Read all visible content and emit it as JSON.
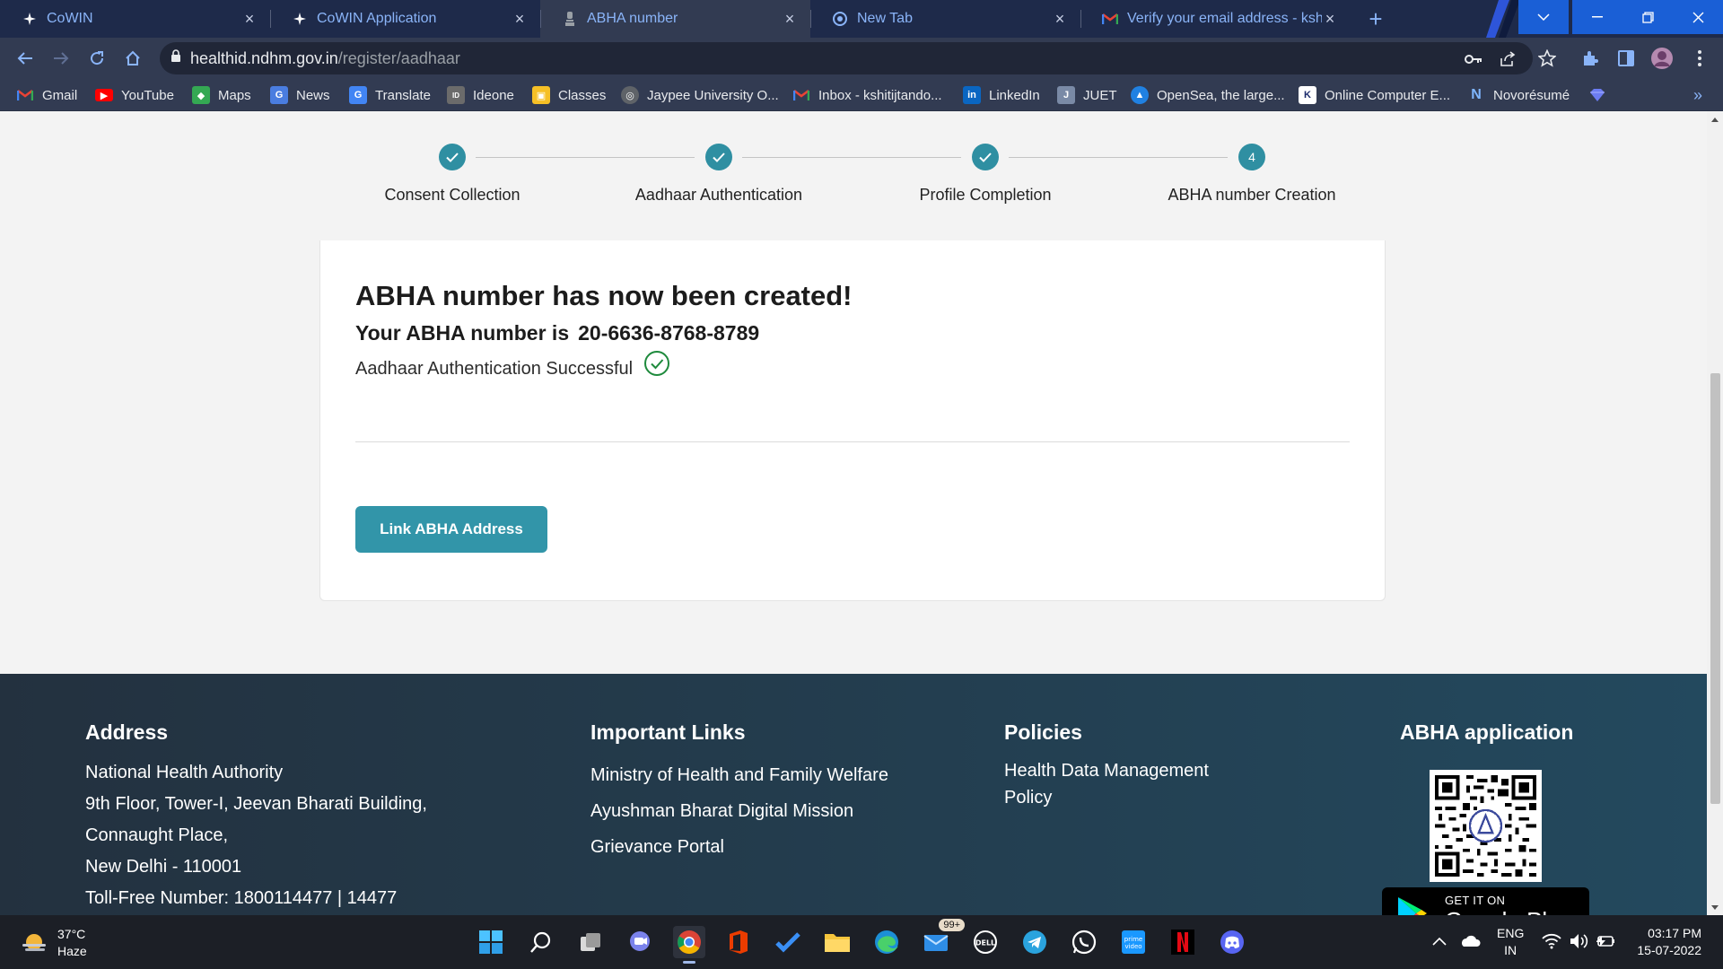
{
  "browser": {
    "tabs": [
      {
        "title": "CoWIN",
        "favicon": "cowin-icon",
        "active": false
      },
      {
        "title": "CoWIN Application",
        "favicon": "cowin-icon",
        "active": false
      },
      {
        "title": "ABHA number",
        "favicon": "emblem-icon",
        "active": true
      },
      {
        "title": "New Tab",
        "favicon": "chrome-icon",
        "active": false
      },
      {
        "title": "Verify your email address - kshiti",
        "favicon": "gmail-icon",
        "active": false
      }
    ],
    "url_host": "healthid.ndhm.gov.in",
    "url_path": "/register/aadhaar",
    "bookmarks": [
      {
        "label": "Gmail",
        "icon": "gmail-icon"
      },
      {
        "label": "YouTube",
        "icon": "youtube-icon"
      },
      {
        "label": "Maps",
        "icon": "maps-icon"
      },
      {
        "label": "News",
        "icon": "news-icon"
      },
      {
        "label": "Translate",
        "icon": "translate-icon"
      },
      {
        "label": "Ideone",
        "icon": "ideone-icon"
      },
      {
        "label": "Classes",
        "icon": "classroom-icon"
      },
      {
        "label": "Jaypee University O...",
        "icon": "globe-icon"
      },
      {
        "label": "Inbox - kshitijtando...",
        "icon": "gmail-icon"
      },
      {
        "label": "LinkedIn",
        "icon": "linkedin-icon"
      },
      {
        "label": "JUET",
        "icon": "juet-icon"
      },
      {
        "label": "OpenSea, the large...",
        "icon": "opensea-icon"
      },
      {
        "label": "Online Computer E...",
        "icon": "online-exam-icon"
      },
      {
        "label": "Novorésumé",
        "icon": "novoresume-icon"
      },
      {
        "label": "",
        "icon": "gem-icon"
      }
    ],
    "more_label": "»"
  },
  "stepper": {
    "steps": [
      {
        "label": "Consent Collection",
        "state": "done",
        "marker": ""
      },
      {
        "label": "Aadhaar Authentication",
        "state": "done",
        "marker": ""
      },
      {
        "label": "Profile Completion",
        "state": "done",
        "marker": ""
      },
      {
        "label": "ABHA number Creation",
        "state": "current",
        "marker": "4"
      }
    ]
  },
  "result": {
    "title": "ABHA number has now been created!",
    "number_prefix": "Your ABHA number is",
    "number": "20-6636-8768-8789",
    "auth_status": "Aadhaar Authentication Successful",
    "link_button": "Link ABHA Address"
  },
  "footer": {
    "address": {
      "heading": "Address",
      "lines": [
        "National Health Authority",
        "9th Floor, Tower-I, Jeevan Bharati Building,",
        "Connaught Place,",
        "New Delhi - 110001",
        "Toll-Free Number: 1800114477 | 14477"
      ]
    },
    "links": {
      "heading": "Important Links",
      "items": [
        "Ministry of Health and Family Welfare",
        "Ayushman Bharat Digital Mission",
        "Grievance Portal"
      ]
    },
    "policies": {
      "heading": "Policies",
      "items": [
        "Health Data Management",
        "Policy"
      ]
    },
    "app": {
      "heading": "ABHA application",
      "store_small": "GET IT ON",
      "store_big": "Google Play"
    }
  },
  "taskbar": {
    "weather_temp": "37°C",
    "weather_desc": "Haze",
    "mail_badge": "99+",
    "lang_top": "ENG",
    "lang_bottom": "IN",
    "time": "03:17 PM",
    "date": "15-07-2022"
  },
  "colors": {
    "accent": "#3295a9",
    "step": "#2f8fa2",
    "success": "#1e8a3c",
    "footer_start": "#23313f",
    "footer_end": "#23495e"
  }
}
